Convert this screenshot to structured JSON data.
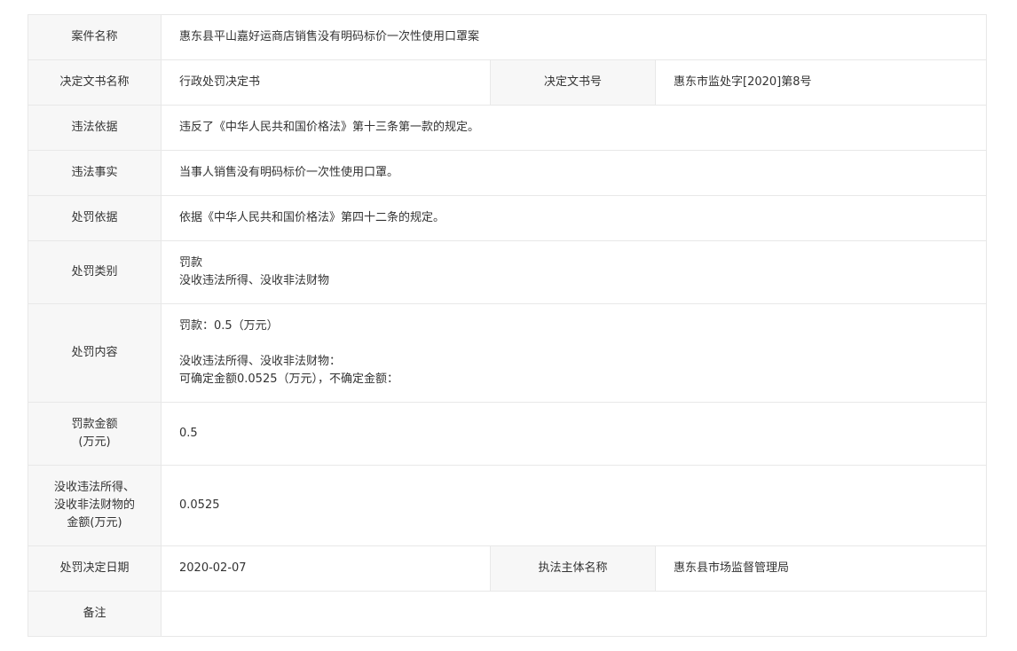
{
  "rows": {
    "case_name": {
      "label": "案件名称",
      "value": "惠东县平山嘉好运商店销售没有明码标价一次性使用口罩案"
    },
    "doc_name": {
      "label": "决定文书名称",
      "value": "行政处罚决定书",
      "label2": "决定文书号",
      "value2": "惠东市监处字[2020]第8号"
    },
    "violation_basis": {
      "label": "违法依据",
      "value": "违反了《中华人民共和国价格法》第十三条第一款的规定。"
    },
    "violation_facts": {
      "label": "违法事实",
      "value": "当事人销售没有明码标价一次性使用口罩。"
    },
    "penalty_basis": {
      "label": "处罚依据",
      "value": "依据《中华人民共和国价格法》第四十二条的规定。"
    },
    "penalty_type": {
      "label": "处罚类别",
      "line1": "罚款",
      "line2": "没收违法所得、没收非法财物"
    },
    "penalty_content": {
      "label": "处罚内容",
      "line1": "罚款：0.5（万元）",
      "line2": "没收违法所得、没收非法财物：",
      "line3": "可确定金额0.0525（万元），不确定金额："
    },
    "fine_amount": {
      "label_line1": "罚款金额",
      "label_line2": "(万元)",
      "value": "0.5"
    },
    "confiscation_amount": {
      "label_line1": "没收违法所得、",
      "label_line2": "没收非法财物的",
      "label_line3": "金额(万元)",
      "value": "0.0525"
    },
    "decision_date": {
      "label": "处罚决定日期",
      "value": "2020-02-07",
      "label2": "执法主体名称",
      "value2": "惠东县市场监督管理局"
    },
    "remarks": {
      "label": "备注",
      "value": ""
    }
  }
}
